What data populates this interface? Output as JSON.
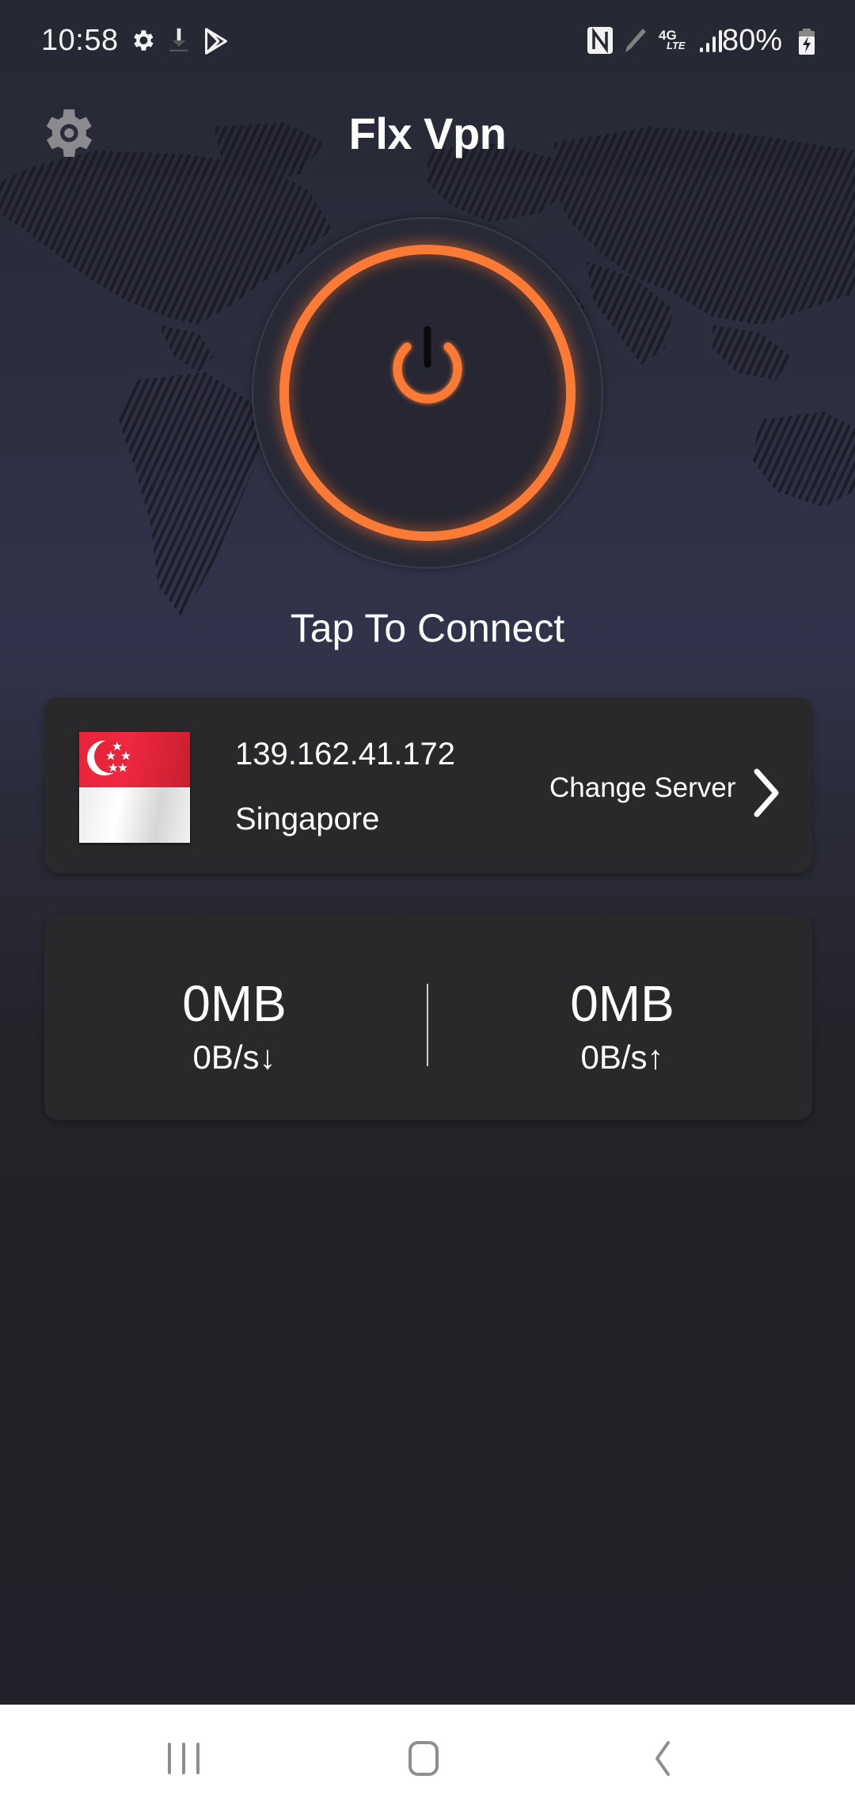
{
  "status_bar": {
    "time": "10:58",
    "left_icons": [
      "settings-icon",
      "download-icon",
      "play-store-icon"
    ],
    "right_icons": [
      "nfc-icon",
      "pen-icon",
      "4g-lte-icon",
      "signal-icon"
    ],
    "network_label_top": "4G",
    "network_label_bottom": "LTE",
    "battery_percent": "80%",
    "battery_charging": true
  },
  "header": {
    "title": "Flx Vpn",
    "settings_icon": "gear-icon"
  },
  "power": {
    "icon": "power-icon",
    "label": "Tap To Connect",
    "accent_color": "#fb7a35"
  },
  "server": {
    "flag": "singapore-flag",
    "ip": "139.162.41.172",
    "country": "Singapore",
    "change_label": "Change Server",
    "chevron_icon": "chevron-right-icon"
  },
  "stats": {
    "download": {
      "total": "0MB",
      "speed": "0B/s↓"
    },
    "upload": {
      "total": "0MB",
      "speed": "0B/s↑"
    }
  },
  "nav_bar": {
    "items": [
      {
        "name": "recents",
        "icon": "recents-icon"
      },
      {
        "name": "home",
        "icon": "home-icon"
      },
      {
        "name": "back",
        "icon": "back-icon"
      }
    ]
  }
}
